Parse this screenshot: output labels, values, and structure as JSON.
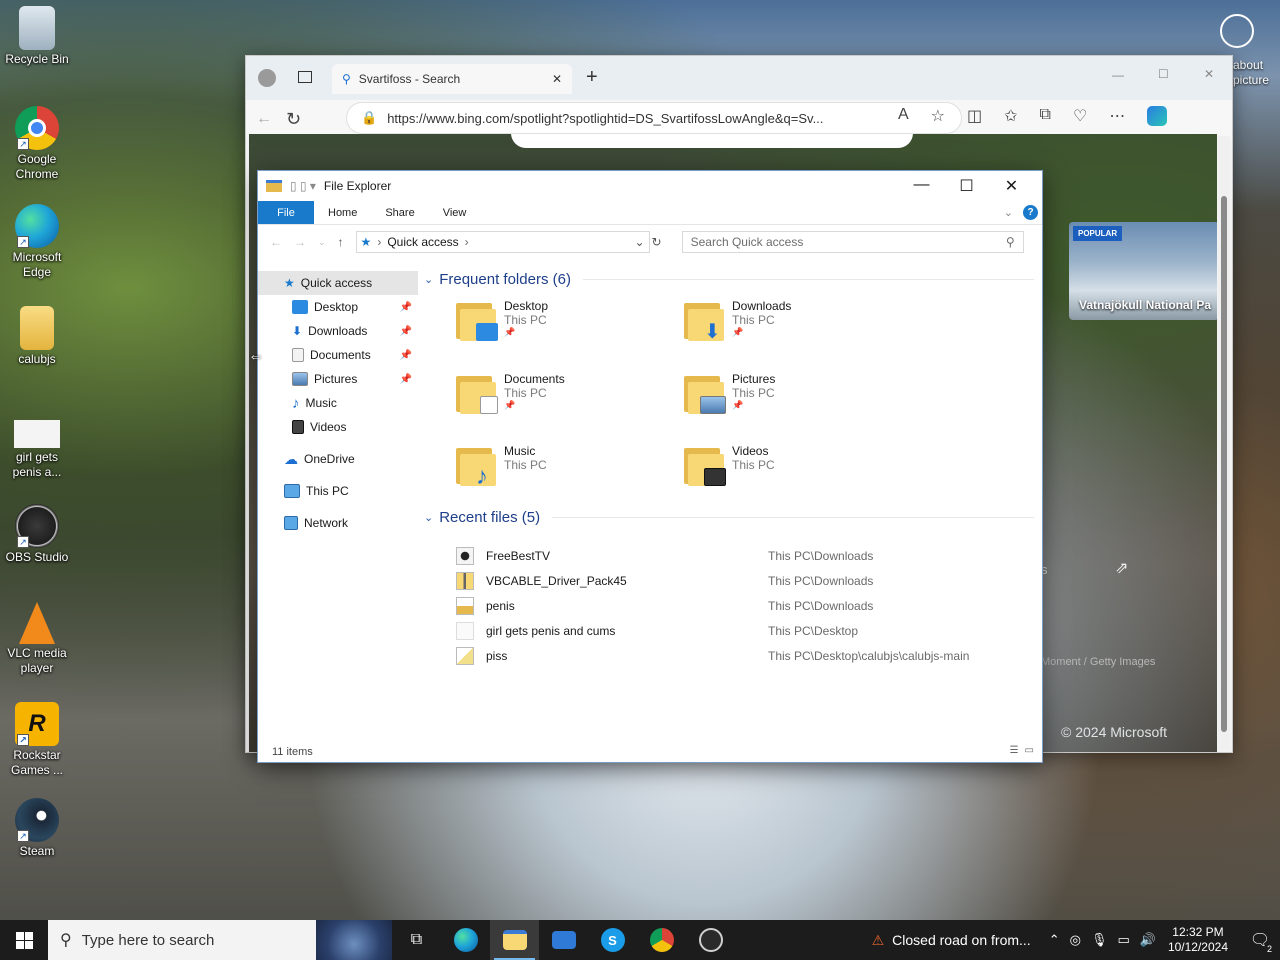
{
  "desktop": {
    "icons": [
      {
        "label": "Recycle Bin"
      },
      {
        "label": "Google Chrome"
      },
      {
        "label": "Microsoft Edge"
      },
      {
        "label": "calubjs"
      },
      {
        "label": "girl gets penis a..."
      },
      {
        "label": "OBS Studio"
      },
      {
        "label": "VLC media player"
      },
      {
        "label": "Rockstar Games ..."
      },
      {
        "label": "Steam"
      }
    ],
    "top_right_text": "about\npicture"
  },
  "browser": {
    "tab_title": "Svartifoss - Search",
    "url": "https://www.bing.com/spotlight?spotlightid=DS_SvartifossLowAngle&q=Sv...",
    "popular_badge": "POPULAR",
    "popular_title": "Vatnajökull National Pa",
    "credit": "Moment / Getty Images",
    "copyright": "© 2024 Microsoft",
    "partial_text": "s"
  },
  "explorer": {
    "title": "File Explorer",
    "ribbon_tabs": [
      "File",
      "Home",
      "Share",
      "View"
    ],
    "breadcrumb": "Quick access",
    "search_placeholder": "Search Quick access",
    "nav": {
      "quick_access": "Quick access",
      "items": [
        "Desktop",
        "Downloads",
        "Documents",
        "Pictures",
        "Music",
        "Videos"
      ],
      "onedrive": "OneDrive",
      "this_pc": "This PC",
      "network": "Network"
    },
    "frequent_header": "Frequent folders (6)",
    "frequent": [
      {
        "name": "Desktop",
        "loc": "This PC"
      },
      {
        "name": "Downloads",
        "loc": "This PC"
      },
      {
        "name": "Documents",
        "loc": "This PC"
      },
      {
        "name": "Pictures",
        "loc": "This PC"
      },
      {
        "name": "Music",
        "loc": "This PC"
      },
      {
        "name": "Videos",
        "loc": "This PC"
      }
    ],
    "recent_header": "Recent files (5)",
    "recent": [
      {
        "name": "FreeBestTV",
        "loc": "This PC\\Downloads"
      },
      {
        "name": "VBCABLE_Driver_Pack45",
        "loc": "This PC\\Downloads"
      },
      {
        "name": "penis",
        "loc": "This PC\\Downloads"
      },
      {
        "name": "girl gets penis and cums",
        "loc": "This PC\\Desktop"
      },
      {
        "name": "piss",
        "loc": "This PC\\Desktop\\calubjs\\calubjs-main"
      }
    ],
    "status": "11 items"
  },
  "taskbar": {
    "search_placeholder": "Type here to search",
    "news": "Closed road on from...",
    "time": "12:32 PM",
    "date": "10/12/2024",
    "notif_count": "2"
  },
  "colors": {
    "accent": "#1979ca",
    "folder": "#f8d775",
    "taskbar": "#1c1c1c"
  }
}
